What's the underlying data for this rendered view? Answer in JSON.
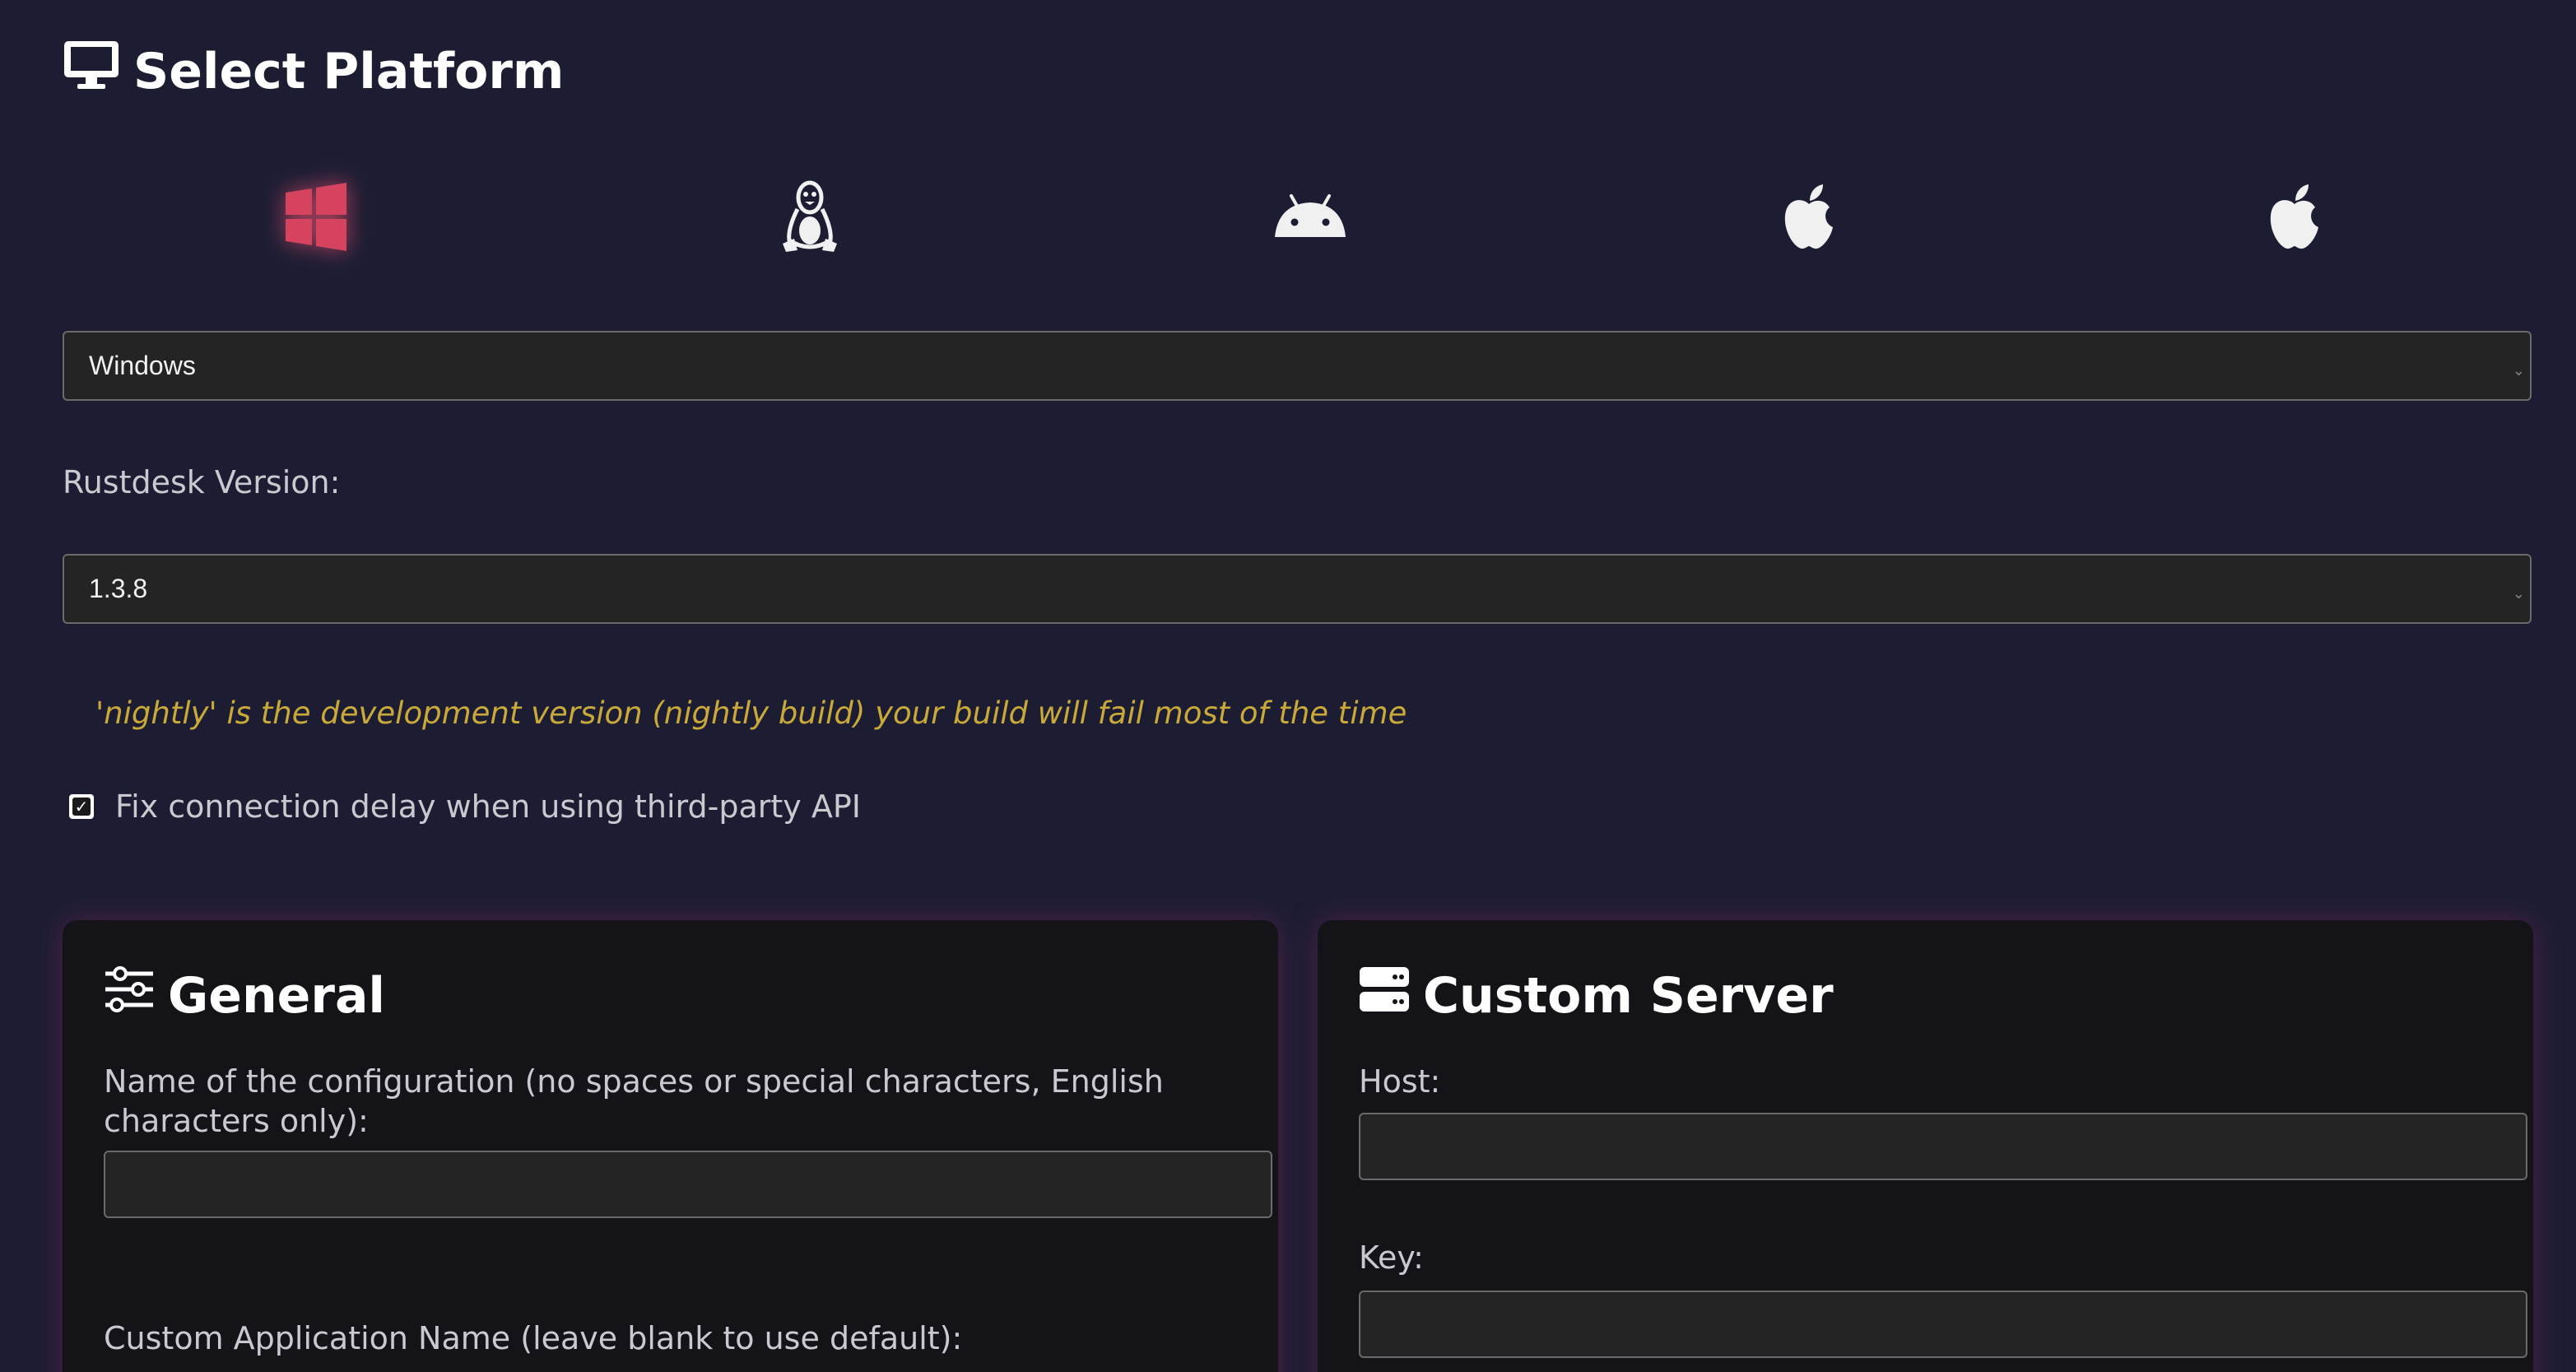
{
  "header": {
    "title": "Select Platform",
    "icon": "monitor-icon"
  },
  "platforms": [
    {
      "name": "windows",
      "icon": "windows-icon",
      "active": true,
      "color": "#d6435f"
    },
    {
      "name": "linux",
      "icon": "linux-icon",
      "active": false
    },
    {
      "name": "android",
      "icon": "android-icon",
      "active": false
    },
    {
      "name": "macos",
      "icon": "apple-icon",
      "active": false
    },
    {
      "name": "ios",
      "icon": "apple-icon",
      "active": false
    }
  ],
  "platform_select": {
    "value": "Windows"
  },
  "version": {
    "label": "Rustdesk Version:",
    "value": "1.3.8"
  },
  "warning": {
    "text": "'nightly' is the development version (nightly build) your build will fail most of the time",
    "color": "#c9a93a"
  },
  "fix_delay": {
    "label": "Fix connection delay when using third-party API",
    "checked": true
  },
  "general": {
    "title": "General",
    "icon": "sliders-icon",
    "config_name_label": "Name of the configuration (no spaces or special characters, English characters only):",
    "config_name_value": "",
    "app_name_label": "Custom Application Name (leave blank to use default):"
  },
  "custom_server": {
    "title": "Custom Server",
    "icon": "server-icon",
    "host_label": "Host:",
    "host_value": "",
    "key_label": "Key:",
    "key_value": ""
  }
}
